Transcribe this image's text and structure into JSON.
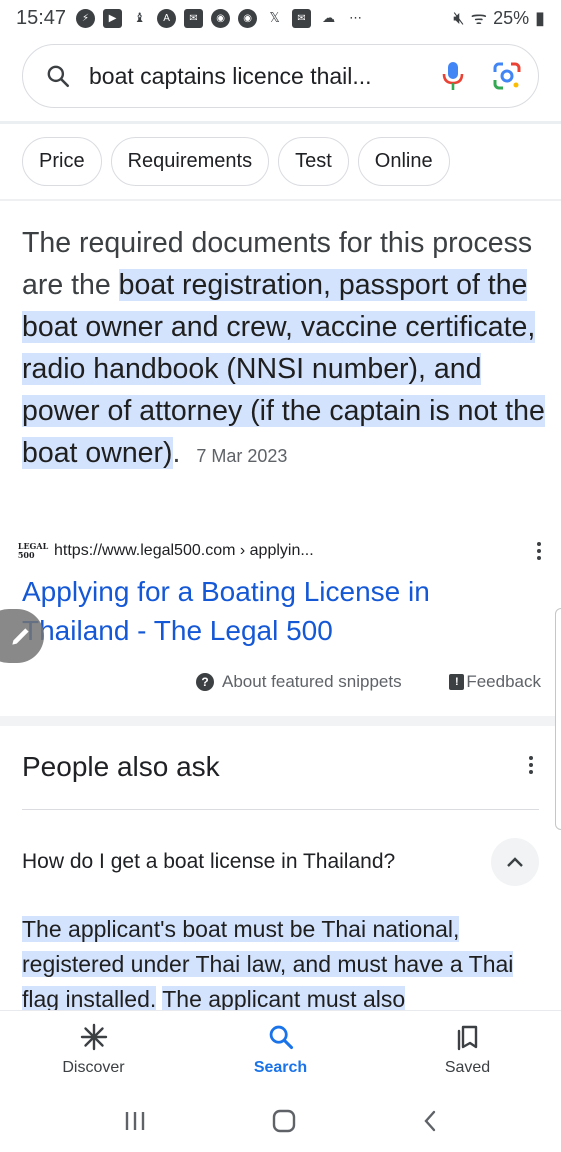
{
  "status": {
    "time": "15:47",
    "battery": "25%"
  },
  "search": {
    "query": "boat captains licence thail..."
  },
  "chips": [
    "Price",
    "Requirements",
    "Test",
    "Online"
  ],
  "snippet": {
    "plain_text": "The required documents for this process are the ",
    "highlighted_text": "boat registration, passport of the boat owner and crew, vaccine certificate, radio handbook (NNSI number), and power of attorney (if the captain is not the boat owner)",
    "trailing": ".",
    "date": "7 Mar 2023",
    "source_url": "https://www.legal500.com › applyin...",
    "favicon_text": "LEGAL 500",
    "title": "Applying for a Boating License in Thailand - The Legal 500",
    "about_label": "About featured snippets",
    "feedback_label": "Feedback"
  },
  "paa": {
    "title": "People also ask",
    "question": "How do I get a boat license in Thailand?",
    "answer_highlighted_1": "The applicant's boat must be Thai national, registered under Thai law, and must have a Thai flag installed.",
    "answer_highlighted_2": "The applicant must also"
  },
  "bottom_nav": {
    "discover": "Discover",
    "search": "Search",
    "saved": "Saved"
  },
  "colors": {
    "highlight": "#d3e3fd",
    "link": "#1558d6",
    "active_nav": "#1a73e8"
  }
}
